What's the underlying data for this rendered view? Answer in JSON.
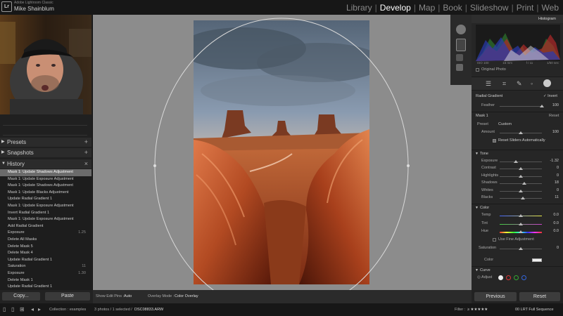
{
  "app": {
    "title": "Adobe Lightroom Classic",
    "user": "Mike Shainblum",
    "logo": "Lr"
  },
  "modules": [
    "Library",
    "Develop",
    "Map",
    "Book",
    "Slideshow",
    "Print",
    "Web"
  ],
  "active_module": "Develop",
  "left_panel": {
    "presets_label": "Presets",
    "snapshots_label": "Snapshots",
    "history_label": "History",
    "history": [
      {
        "label": "Mask 1: Update Shadows Adjustment",
        "selected": true,
        "v1": "",
        "v2": ""
      },
      {
        "label": "Mask 1: Update Exposure Adjustment",
        "v1": "",
        "v2": ""
      },
      {
        "label": "Mask 1: Update Shadows Adjustment",
        "v1": "",
        "v2": ""
      },
      {
        "label": "Mask 1: Update Blacks Adjustment",
        "v1": "",
        "v2": ""
      },
      {
        "label": "Update Radial Gradient 1",
        "v1": "",
        "v2": ""
      },
      {
        "label": "Mask 1: Update Exposure Adjustment",
        "v1": "",
        "v2": ""
      },
      {
        "label": "Invert Radial Gradient 1",
        "v1": "",
        "v2": ""
      },
      {
        "label": "Mask 1: Update Exposure Adjustment",
        "v1": "",
        "v2": ""
      },
      {
        "label": "Add Radial Gradient",
        "v1": "",
        "v2": ""
      },
      {
        "label": "Exposure",
        "v1": "",
        "v2": "1.25"
      },
      {
        "label": "Delete All Masks",
        "v1": "",
        "v2": ""
      },
      {
        "label": "Delete Mask 5",
        "v1": "",
        "v2": ""
      },
      {
        "label": "Delete Mask 4",
        "v1": "",
        "v2": ""
      },
      {
        "label": "Update Radial Gradient 1",
        "v1": "",
        "v2": ""
      },
      {
        "label": "Saturation",
        "v1": "",
        "v2": "11"
      },
      {
        "label": "Exposure",
        "v1": "",
        "v2": "1.30"
      },
      {
        "label": "Delete Mask 1",
        "v1": "",
        "v2": ""
      },
      {
        "label": "Update Radial Gradient 1",
        "v1": "",
        "v2": ""
      }
    ],
    "copy_label": "Copy...",
    "paste_label": "Paste"
  },
  "toolbar": {
    "edit_pins_label": "Show Edit Pins :",
    "edit_pins_value": "Auto",
    "overlay_label": "Overlay Mode :",
    "overlay_value": "Color Overlay"
  },
  "right_panel": {
    "histogram_label": "Histogram",
    "original_photo_label": "Original Photo",
    "hist_readouts": [
      "ISO 100",
      "16 mm",
      "f / 11",
      "1/50 sec"
    ],
    "radial_label": "Radial Gradient",
    "invert_label": "Invert",
    "feather_label": "Feather",
    "feather_value": "100",
    "mask_label": "Mask 1",
    "reset_label": "Reset",
    "preset_label": "Preset",
    "preset_value": "Custom",
    "amount_label": "Amount",
    "amount_value": "100",
    "reset_sliders_label": "Reset Sliders Automatically",
    "tone_label": "Tone",
    "tone": [
      {
        "label": "Exposure",
        "value": "-1.32",
        "pos": 0.38
      },
      {
        "label": "Contrast",
        "value": "0",
        "pos": 0.5
      },
      {
        "label": "Highlights",
        "value": "0",
        "pos": 0.5
      },
      {
        "label": "Shadows",
        "value": "18",
        "pos": 0.59
      },
      {
        "label": "Whites",
        "value": "0",
        "pos": 0.5
      },
      {
        "label": "Blacks",
        "value": "11",
        "pos": 0.555
      }
    ],
    "color_label": "Color",
    "color_sliders": [
      {
        "label": "Temp",
        "value": "0.0",
        "pos": 0.5
      },
      {
        "label": "Tint",
        "value": "0.0",
        "pos": 0.5
      },
      {
        "label": "Hue",
        "value": "0.0",
        "pos": 0.5
      }
    ],
    "fine_adjust_label": "Use Fine Adjustment",
    "saturation_label": "Saturation",
    "saturation_value": "0",
    "color_swatch_label": "Color",
    "curve_label": "Curve",
    "adjust_label": "Adjust",
    "previous_label": "Previous",
    "reset_button_label": "Reset"
  },
  "footer": {
    "collection": "Collection : examples",
    "count": "3 photos / 1 selected /",
    "filename": "DSC08833.ARW",
    "filter_label": "Filter :",
    "sequence": "00 LRT Full Sequence"
  },
  "colors": {
    "accent": "#ffffff",
    "panel": "#262626",
    "canvas": "#8c8c8c"
  }
}
